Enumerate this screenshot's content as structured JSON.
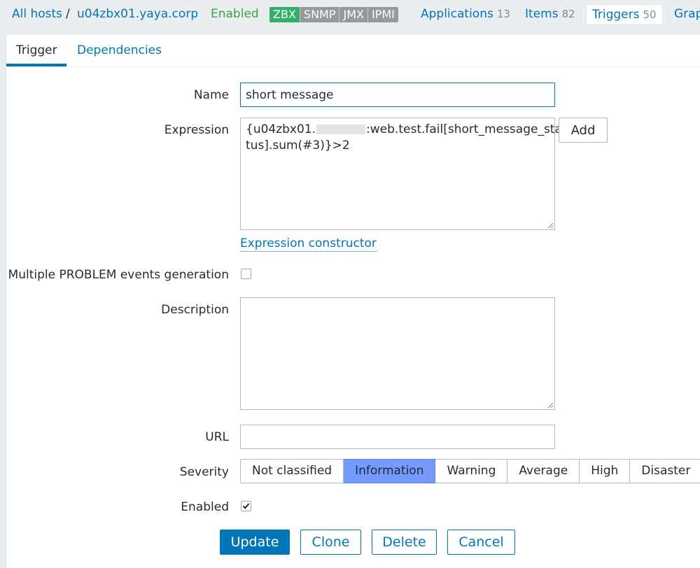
{
  "breadcrumbs": {
    "all_hosts": "All hosts",
    "separator": "/",
    "host": "u04zbx01.yaya.corp"
  },
  "host_status": "Enabled",
  "availability": [
    "ZBX",
    "SNMP",
    "JMX",
    "IPMI"
  ],
  "host_nav": [
    {
      "label": "Applications",
      "count": "13"
    },
    {
      "label": "Items",
      "count": "82"
    },
    {
      "label": "Triggers",
      "count": "50"
    },
    {
      "label": "Grap",
      "count": ""
    }
  ],
  "tabs": {
    "trigger": "Trigger",
    "dependencies": "Dependencies"
  },
  "form": {
    "name": {
      "label": "Name",
      "value": "short message"
    },
    "expression": {
      "label": "Expression",
      "value_start": "{u04zbx01.",
      "value_end": ":web.test.fail[short_message_sta",
      "value_line2": "tus].sum(#3)}>2",
      "add_button": "Add",
      "constructor_link": "Expression constructor"
    },
    "multiple_events": {
      "label": "Multiple PROBLEM events generation",
      "checked": false
    },
    "description": {
      "label": "Description",
      "value": ""
    },
    "url": {
      "label": "URL",
      "value": ""
    },
    "severity": {
      "label": "Severity",
      "options": [
        "Not classified",
        "Information",
        "Warning",
        "Average",
        "High",
        "Disaster"
      ],
      "selected": "Information"
    },
    "enabled": {
      "label": "Enabled",
      "checked": true
    }
  },
  "actions": {
    "update": "Update",
    "clone": "Clone",
    "delete": "Delete",
    "cancel": "Cancel"
  },
  "colors": {
    "link": "#0275b8",
    "enabled_green": "#429e47",
    "zbx_available": "#34af67",
    "severity_information": "#7499ff",
    "severity_disaster": "#e45959"
  }
}
